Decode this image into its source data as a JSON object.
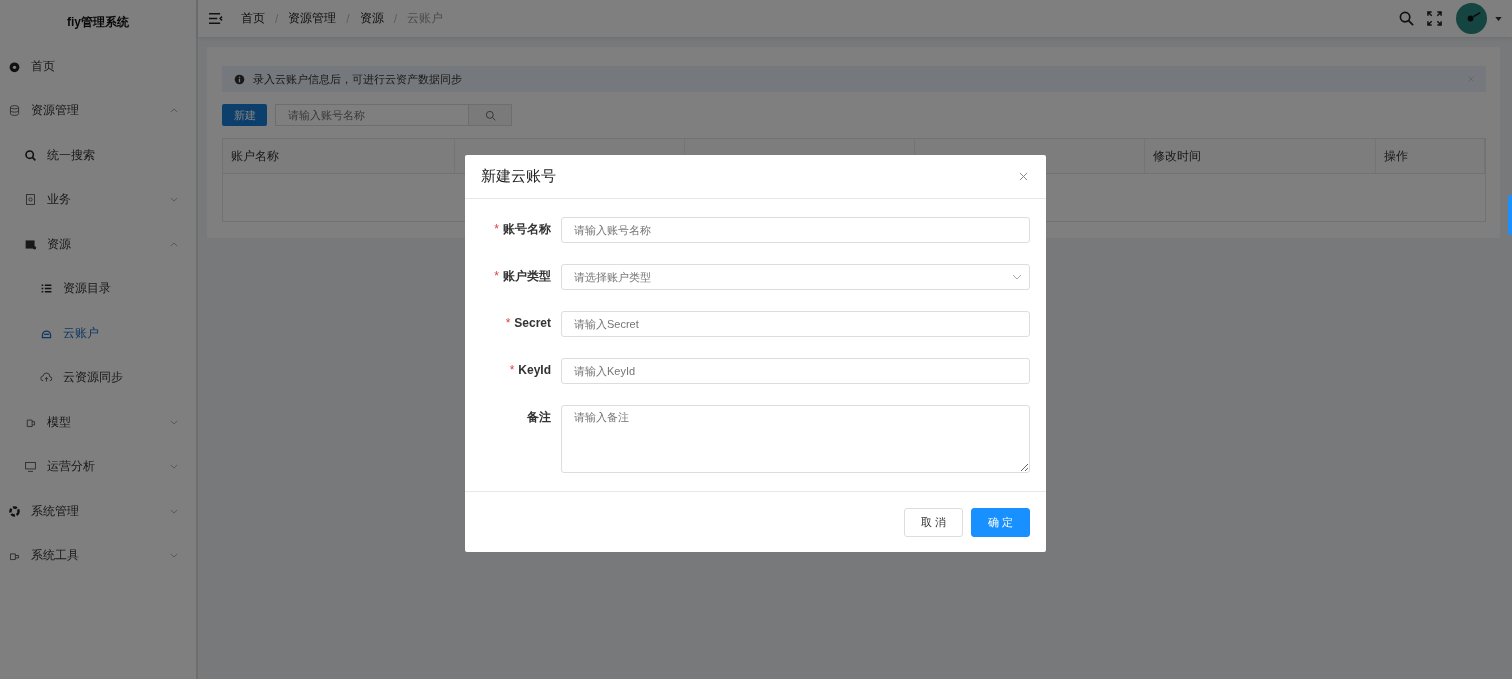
{
  "sidebar": {
    "title": "fiy管理系统",
    "items": [
      {
        "label": "首页",
        "selected": false
      },
      {
        "label": "资源管理",
        "expanded": true,
        "selected": false,
        "children": [
          {
            "label": "统一搜索",
            "selected": false
          },
          {
            "label": "业务",
            "expanded": false,
            "selected": false
          },
          {
            "label": "资源",
            "expanded": true,
            "selected": false,
            "children": [
              {
                "label": "资源目录",
                "selected": false
              },
              {
                "label": "云账户",
                "selected": true
              },
              {
                "label": "云资源同步",
                "selected": false
              }
            ]
          },
          {
            "label": "模型",
            "expanded": false,
            "selected": false
          },
          {
            "label": "运营分析",
            "expanded": false,
            "selected": false
          }
        ]
      },
      {
        "label": "系统管理",
        "expanded": false,
        "selected": false
      },
      {
        "label": "系统工具",
        "expanded": false,
        "selected": false
      }
    ]
  },
  "breadcrumb": {
    "separator": "/",
    "items": [
      "首页",
      "资源管理",
      "资源",
      "云账户"
    ]
  },
  "alert": {
    "text": "录入云账户信息后，可进行云资产数据同步"
  },
  "toolbar": {
    "new_button": "新建",
    "search": {
      "placeholder": "请输入账号名称"
    }
  },
  "table": {
    "columns_left": [
      "账户名称"
    ],
    "columns_right": [
      "修改时间",
      "操作"
    ]
  },
  "dialog": {
    "title": "新建云账号",
    "required_mark": "*",
    "fields": [
      {
        "label": "账号名称",
        "required": true,
        "kind": "input",
        "placeholder": "请输入账号名称"
      },
      {
        "label": "账户类型",
        "required": true,
        "kind": "select",
        "placeholder": "请选择账户类型"
      },
      {
        "label": "Secret",
        "required": true,
        "kind": "input",
        "placeholder": "请输入Secret"
      },
      {
        "label": "KeyId",
        "required": true,
        "kind": "input",
        "placeholder": "请输入KeyId"
      },
      {
        "label": "备注",
        "required": false,
        "kind": "textarea",
        "placeholder": "请输入备注"
      }
    ],
    "buttons": [
      {
        "label": "取 消",
        "kind": "default"
      },
      {
        "label": "确 定",
        "kind": "primary"
      }
    ]
  }
}
